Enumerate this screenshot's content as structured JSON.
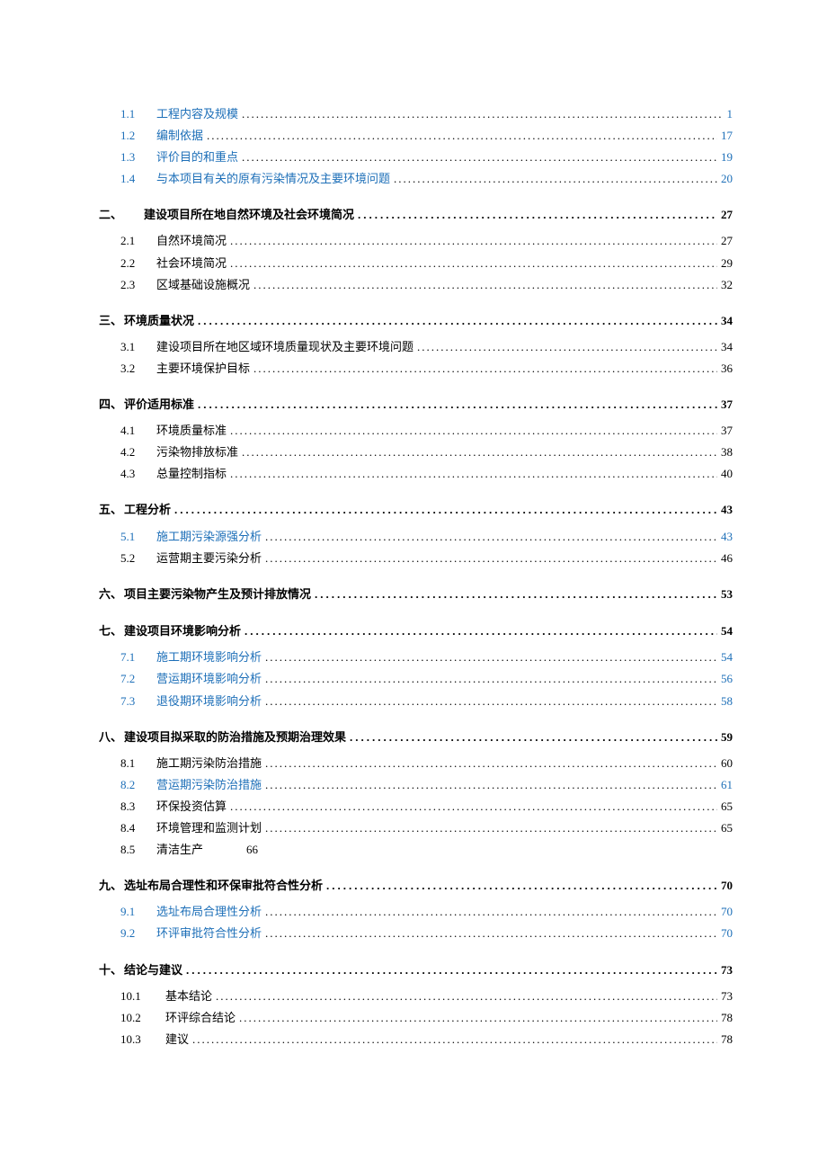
{
  "dot_fill": "........................................................................................................................................................................................",
  "sections": [
    {
      "num": "",
      "label": "",
      "page": "",
      "hidden": true,
      "wide_gap": false,
      "items": [
        {
          "num": "1.1",
          "label": "工程内容及规模",
          "page": "1",
          "link": true
        },
        {
          "num": "1.2",
          "label": "编制依据",
          "page": "17",
          "link": true
        },
        {
          "num": "1.3",
          "label": "评价目的和重点",
          "page": "19",
          "link": true
        },
        {
          "num": "1.4",
          "label": "与本项目有关的原有污染情况及主要环境问题",
          "page": "20",
          "link": true
        }
      ]
    },
    {
      "num": "二、",
      "label": "建设项目所在地自然环境及社会环境简况",
      "page": "27",
      "wide_gap": true,
      "items": [
        {
          "num": "2.1",
          "label": "自然环境简况",
          "page": "27",
          "link": false
        },
        {
          "num": "2.2",
          "label": "社会环境简况",
          "page": "29",
          "link": false
        },
        {
          "num": "2.3",
          "label": "区域基础设施概况",
          "page": "32",
          "link": false
        }
      ]
    },
    {
      "num": "三、",
      "label": "环境质量状况",
      "page": "34",
      "items": [
        {
          "num": "3.1",
          "label": "建设项目所在地区域环境质量现状及主要环境问题",
          "page": "34",
          "link": false
        },
        {
          "num": "3.2",
          "label": "主要环境保护目标",
          "page": "36",
          "link": false
        }
      ]
    },
    {
      "num": "四、",
      "label": "评价适用标准",
      "page": "37",
      "items": [
        {
          "num": "4.1",
          "label": "环境质量标准",
          "page": "37",
          "link": false
        },
        {
          "num": "4.2",
          "label": "污染物排放标准",
          "page": "38",
          "link": false
        },
        {
          "num": "4.3",
          "label": "总量控制指标",
          "page": "40",
          "link": false
        }
      ]
    },
    {
      "num": "五、",
      "label": "工程分析",
      "page": "43",
      "items": [
        {
          "num": "5.1",
          "label": "施工期污染源强分析",
          "page": "43",
          "link": true
        },
        {
          "num": "5.2",
          "label": "运营期主要污染分析",
          "page": "46",
          "link": false
        }
      ]
    },
    {
      "num": "六、",
      "label": "项目主要污染物产生及预计排放情况",
      "page": "53",
      "items": []
    },
    {
      "num": "七、",
      "label": "建设项目环境影响分析",
      "page": "54",
      "items": [
        {
          "num": "7.1",
          "label": "施工期环境影响分析",
          "page": "54",
          "link": true
        },
        {
          "num": "7.2",
          "label": "营运期环境影响分析",
          "page": "56",
          "link": true
        },
        {
          "num": "7.3",
          "label": "退役期环境影响分析",
          "page": "58",
          "link": true
        }
      ]
    },
    {
      "num": "八、",
      "label": "建设项目拟采取的防治措施及预期治理效果",
      "page": "59",
      "items": [
        {
          "num": "8.1",
          "label": "施工期污染防治措施",
          "page": "60",
          "link": false
        },
        {
          "num": "8.2",
          "label": "营运期污染防治措施",
          "page": "61",
          "link": true
        },
        {
          "num": "8.3",
          "label": "环保投资估算",
          "page": "65",
          "link": false
        },
        {
          "num": "8.4",
          "label": "环境管理和监测计划",
          "page": "65",
          "link": false
        },
        {
          "num": "8.5",
          "label": "清洁生产",
          "page": "66",
          "link": false,
          "no_dots": true
        }
      ]
    },
    {
      "num": "九、",
      "label": "选址布局合理性和环保审批符合性分析",
      "page": "70",
      "items": [
        {
          "num": "9.1",
          "label": "选址布局合理性分析",
          "page": "70",
          "link": true
        },
        {
          "num": "9.2",
          "label": "环评审批符合性分析",
          "page": "70",
          "link": true
        }
      ]
    },
    {
      "num": "十、",
      "label": "结论与建议",
      "page": "73",
      "sub10": true,
      "items": [
        {
          "num": "10.1",
          "label": "基本结论",
          "page": "73",
          "link": false
        },
        {
          "num": "10.2",
          "label": "环评综合结论",
          "page": "78",
          "link": false
        },
        {
          "num": "10.3",
          "label": "建议",
          "page": "78",
          "link": false
        }
      ]
    }
  ]
}
